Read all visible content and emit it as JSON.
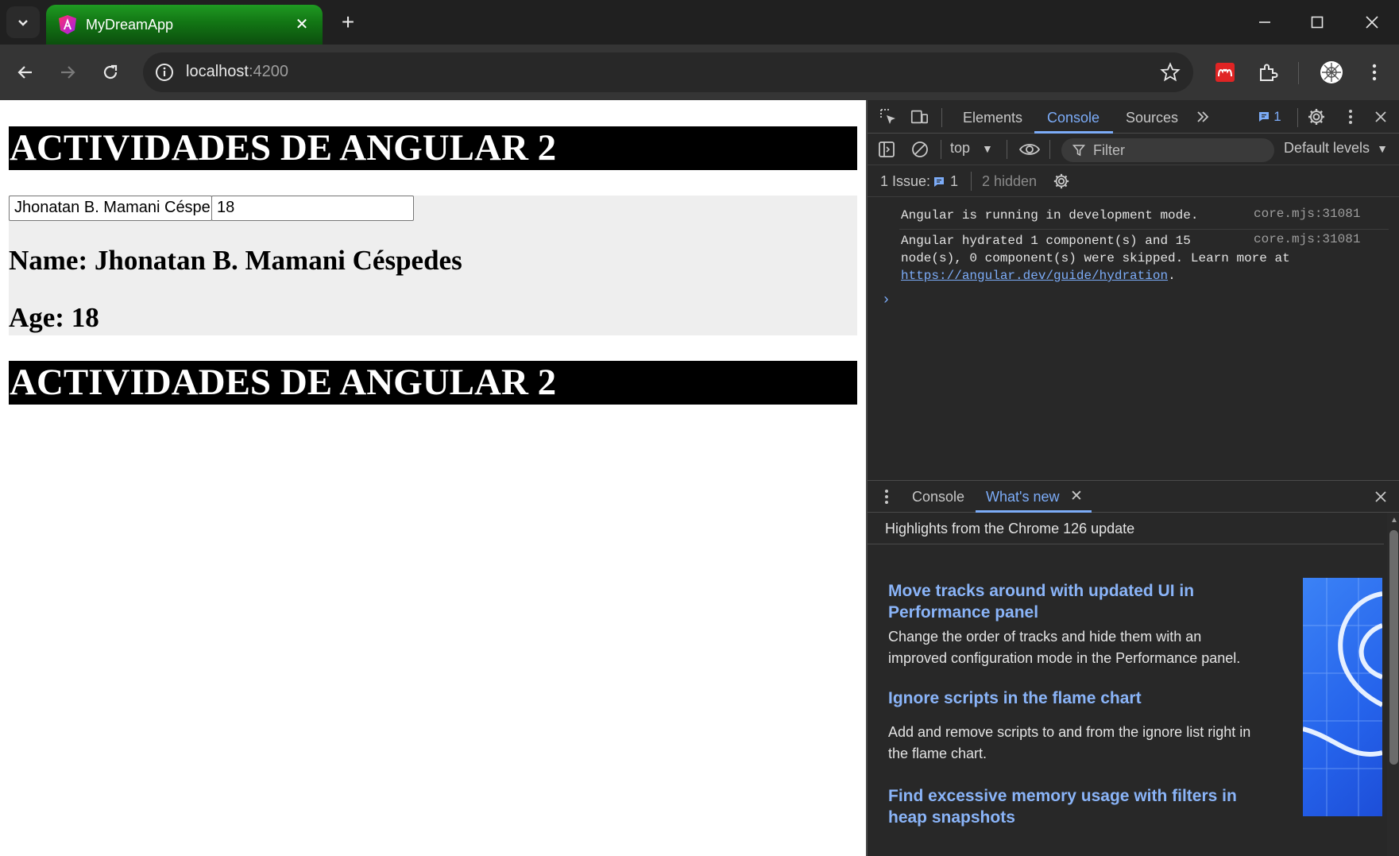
{
  "browser": {
    "tab_title": "MyDreamApp",
    "url_host": "localhost",
    "url_port": ":4200"
  },
  "page": {
    "banner_title": "ACTIVIDADES DE ANGULAR 2",
    "name_input_value": "Jhonatan B. Mamani Céspe",
    "age_input_value": "18",
    "name_text": "Name: Jhonatan B. Mamani Céspedes",
    "age_text": "Age: 18",
    "banner_title_2": "ACTIVIDADES DE ANGULAR 2"
  },
  "devtools": {
    "tabs": [
      "Elements",
      "Console",
      "Sources"
    ],
    "active_tab": "Console",
    "issues_badge": "1",
    "context": "top",
    "filter_placeholder": "Filter",
    "levels": "Default levels",
    "issues_label": "1 Issue:",
    "issues_count": "1",
    "hidden_label": "2 hidden",
    "messages": [
      {
        "text": "Angular is running in development mode.",
        "source": "core.mjs:31081"
      },
      {
        "line1": "Angular hydrated 1 component(s) and 15",
        "line2": "node(s), 0 component(s) were skipped. Learn more at",
        "link": "https://angular.dev/guide/hydration",
        "after_link": ".",
        "source": "core.mjs:31081"
      }
    ],
    "drawer": {
      "tabs": [
        "Console",
        "What's new"
      ],
      "active_tab": "What's new",
      "header": "Highlights from the Chrome 126 update",
      "items": [
        {
          "title": "Move tracks around with updated UI in Performance panel",
          "desc": "Change the order of tracks and hide them with an improved configuration mode in the Performance panel."
        },
        {
          "title": "Ignore scripts in the flame chart",
          "desc": "Add and remove scripts to and from the ignore list right in the flame chart."
        },
        {
          "title": "Find excessive memory usage with filters in heap snapshots",
          "desc": ""
        }
      ]
    }
  },
  "colors": {
    "tab_active": "#127514",
    "devtools_accent": "#7cacf8",
    "link_blue": "#8ab4f8"
  }
}
